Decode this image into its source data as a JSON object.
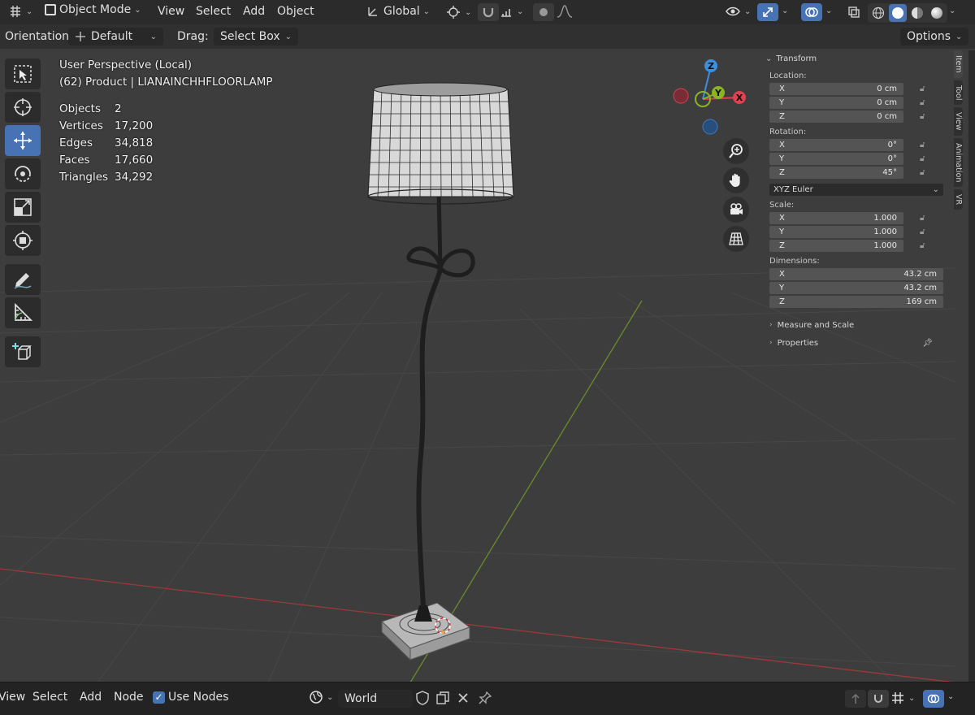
{
  "header": {
    "mode_label": "Object Mode",
    "menus": [
      "View",
      "Select",
      "Add",
      "Object"
    ],
    "transform_orientation": "Global",
    "options_label": "Options"
  },
  "tool_settings": {
    "orientation_label": "Orientation:",
    "orientation_value": "Default",
    "drag_label": "Drag:",
    "drag_value": "Select Box"
  },
  "viewport": {
    "view_name": "User Perspective (Local)",
    "object_info": "(62) Product | LIANAINCHHFLOORLAMP",
    "stats": [
      {
        "label": "Objects",
        "value": "2"
      },
      {
        "label": "Vertices",
        "value": "17,200"
      },
      {
        "label": "Edges",
        "value": "34,818"
      },
      {
        "label": "Faces",
        "value": "17,660"
      },
      {
        "label": "Triangles",
        "value": "34,292"
      }
    ],
    "gizmo": {
      "z": "Z",
      "y": "Y",
      "x": "X"
    }
  },
  "toolbar_tools": [
    "select-box",
    "cursor",
    "move",
    "rotate",
    "scale",
    "transform",
    "annotate",
    "measure",
    "add-cube"
  ],
  "n_panel": {
    "transform_header": "Transform",
    "location_label": "Location:",
    "location": [
      {
        "axis": "X",
        "value": "0 cm"
      },
      {
        "axis": "Y",
        "value": "0 cm"
      },
      {
        "axis": "Z",
        "value": "0 cm"
      }
    ],
    "rotation_label": "Rotation:",
    "rotation": [
      {
        "axis": "X",
        "value": "0°"
      },
      {
        "axis": "Y",
        "value": "0°"
      },
      {
        "axis": "Z",
        "value": "45°"
      }
    ],
    "rotation_mode": "XYZ Euler",
    "scale_label": "Scale:",
    "scale": [
      {
        "axis": "X",
        "value": "1.000"
      },
      {
        "axis": "Y",
        "value": "1.000"
      },
      {
        "axis": "Z",
        "value": "1.000"
      }
    ],
    "dimensions_label": "Dimensions:",
    "dimensions": [
      {
        "axis": "X",
        "value": "43.2 cm"
      },
      {
        "axis": "Y",
        "value": "43.2 cm"
      },
      {
        "axis": "Z",
        "value": "169 cm"
      }
    ],
    "measure_label": "Measure and Scale",
    "properties_label": "Properties"
  },
  "side_tabs": [
    "Item",
    "Tool",
    "View",
    "Animation",
    "VR"
  ],
  "bottom": {
    "menus": [
      "View",
      "Select",
      "Add",
      "Node"
    ],
    "use_nodes_label": "Use Nodes",
    "world_name": "World"
  },
  "colors": {
    "accent": "#4772b3",
    "axis_x": "#e04050",
    "axis_y": "#8ab325",
    "axis_z": "#3b8ee0"
  }
}
